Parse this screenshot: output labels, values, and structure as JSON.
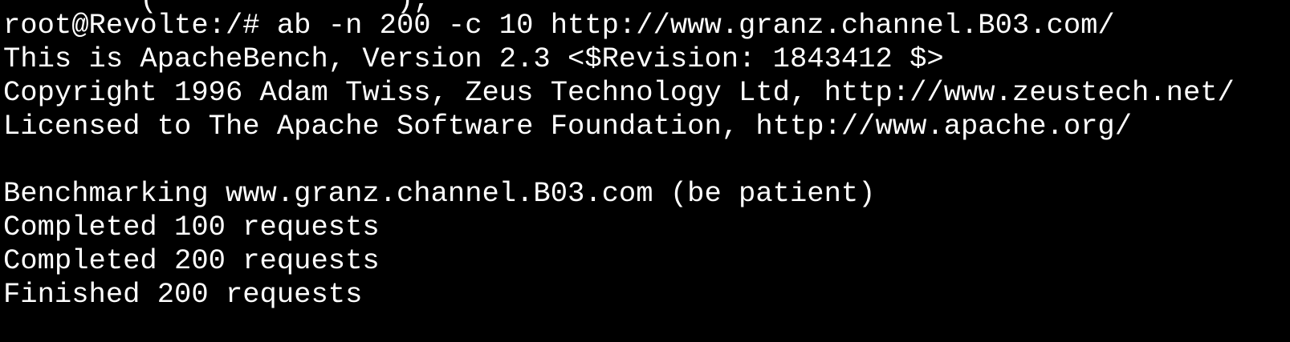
{
  "terminal": {
    "partial_top_line": "        (              ),",
    "lines": [
      "root@Revolte:/# ab -n 200 -c 10 http://www.granz.channel.B03.com/",
      "This is ApacheBench, Version 2.3 <$Revision: 1843412 $>",
      "Copyright 1996 Adam Twiss, Zeus Technology Ltd, http://www.zeustech.net/",
      "Licensed to The Apache Software Foundation, http://www.apache.org/",
      "",
      "Benchmarking www.granz.channel.B03.com (be patient)",
      "Completed 100 requests",
      "Completed 200 requests",
      "Finished 200 requests"
    ],
    "colors": {
      "background": "#000000",
      "foreground": "#ffffff"
    }
  }
}
